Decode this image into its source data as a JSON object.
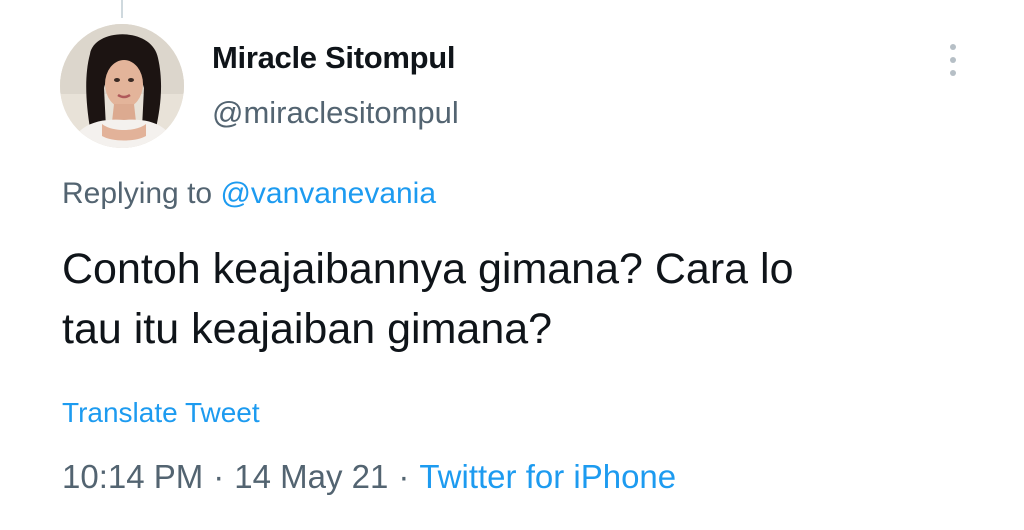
{
  "author": {
    "display_name": "Miracle Sitompul",
    "handle": "@miraclesitompul",
    "avatar": "profile-photo"
  },
  "header": {
    "more_icon": "more-vertical-icon"
  },
  "reply": {
    "prefix": "Replying to",
    "mention": "@vanvanevania"
  },
  "tweet": {
    "text_line_1": "Contoh keajaibannya gimana? Cara lo",
    "text_line_2": "tau itu keajaiban gimana?"
  },
  "translate_label": "Translate Tweet",
  "meta": {
    "time": "10:14 PM",
    "separator": "·",
    "date": "14 May 21",
    "source": "Twitter for iPhone"
  },
  "colors": {
    "link": "#1d9bf0",
    "text": "#0f1419",
    "secondary": "#536471"
  }
}
